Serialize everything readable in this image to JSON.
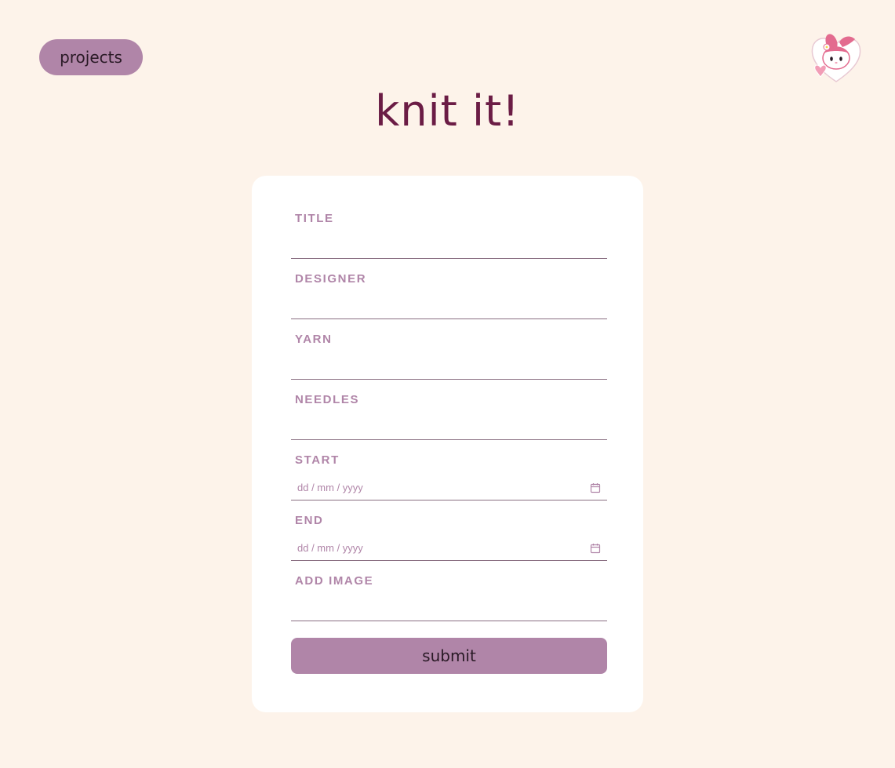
{
  "nav": {
    "projects_label": "projects"
  },
  "header": {
    "title": "knit it!",
    "mascot_icon": "bunny-sticker-icon"
  },
  "form": {
    "fields": [
      {
        "label": "TITLE",
        "value": ""
      },
      {
        "label": "DESIGNER",
        "value": ""
      },
      {
        "label": "YARN",
        "value": ""
      },
      {
        "label": "NEEDLES",
        "value": ""
      },
      {
        "label": "START",
        "placeholder": "dd / mm / yyyy"
      },
      {
        "label": "END",
        "placeholder": "dd / mm / yyyy"
      },
      {
        "label": "ADD IMAGE",
        "value": ""
      }
    ],
    "submit_label": "submit"
  },
  "colors": {
    "background": "#fdf3ea",
    "accent": "#b085a8",
    "title": "#6b1c45",
    "card": "#ffffff"
  }
}
